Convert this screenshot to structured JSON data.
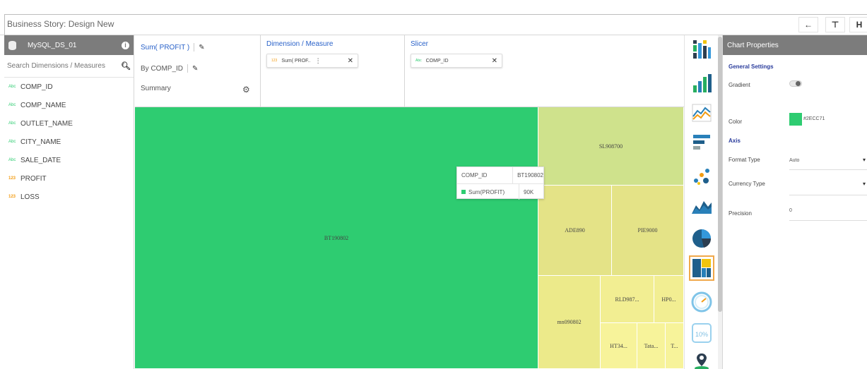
{
  "top_bar": {
    "title": "Business Story: Design New",
    "buttons": [
      {
        "name": "back-arrow-icon",
        "glyph": "←"
      },
      {
        "name": "filter-icon",
        "glyph": "⊤"
      },
      {
        "name": "save-icon",
        "glyph": "H"
      }
    ]
  },
  "datasource": {
    "name": "MySQL_DS_01",
    "search_placeholder": "Search Dimensions / Measures",
    "fields": [
      {
        "type_label": "Abc",
        "kind": "str",
        "name": "COMP_ID"
      },
      {
        "type_label": "Abc",
        "kind": "str",
        "name": "COMP_NAME"
      },
      {
        "type_label": "Abc",
        "kind": "str",
        "name": "OUTLET_NAME"
      },
      {
        "type_label": "Abc",
        "kind": "str",
        "name": "CITY_NAME"
      },
      {
        "type_label": "Abc",
        "kind": "str",
        "name": "SALE_DATE"
      },
      {
        "type_label": "123",
        "kind": "num",
        "name": "PROFIT"
      },
      {
        "type_label": "123",
        "kind": "num",
        "name": "LOSS"
      }
    ]
  },
  "shelf": {
    "measure_title": "Sum( PROFIT )",
    "group_by": "By COMP_ID",
    "summary_label": "Summary",
    "dimension_measure_label": "Dimension / Measure",
    "dimension_pill": {
      "type_label": "123",
      "text": "Sum( PROF.."
    },
    "slicer_label": "Slicer",
    "slicer_pill": {
      "type_label": "Abc",
      "text": "COMP_ID"
    }
  },
  "treemap": {
    "tiles": [
      {
        "label": "BT190802",
        "color": "#2ecc71"
      },
      {
        "label": "SL908700",
        "color": "#cfe28c"
      },
      {
        "label": "ADE890",
        "color": "#e4e387"
      },
      {
        "label": "PIE9000",
        "color": "#e4e387"
      },
      {
        "label": "mn090802",
        "color": "#ecea8a"
      },
      {
        "label": "RLD987...",
        "color": "#f2ee92"
      },
      {
        "label": "HP0...",
        "color": "#f2ee92"
      },
      {
        "label": "HT34...",
        "color": "#f7f39a"
      },
      {
        "label": "Tata...",
        "color": "#f7f39a"
      },
      {
        "label": "T...",
        "color": "#f7f39a"
      }
    ]
  },
  "tooltip": {
    "rows": [
      {
        "key": "COMP_ID",
        "value": "BT190802"
      },
      {
        "key": "Sum(PROFIT)",
        "value": "90K"
      }
    ]
  },
  "chart_types": [
    {
      "name": "grid-chart-icon"
    },
    {
      "name": "bar-chart-icon"
    },
    {
      "name": "line-chart-icon"
    },
    {
      "name": "horizontal-bar-chart-icon"
    },
    {
      "name": "scatter-chart-icon"
    },
    {
      "name": "area-chart-icon"
    },
    {
      "name": "pie-chart-icon"
    },
    {
      "name": "treemap-chart-icon",
      "selected": true
    },
    {
      "name": "gauge-chart-icon"
    },
    {
      "name": "kpi-chart-icon",
      "text": "10%"
    },
    {
      "name": "map-chart-icon"
    }
  ],
  "properties": {
    "title": "Chart Properties",
    "general_settings": "General Settings",
    "gradient_label": "Gradient",
    "color_label": "Color",
    "color_value": "#2ECC71",
    "axis_section": "Axis",
    "format_type_label": "Format Type",
    "format_type_value": "Auto",
    "currency_type_label": "Currency Type",
    "currency_type_value": "",
    "precision_label": "Precision",
    "precision_value": "0"
  }
}
